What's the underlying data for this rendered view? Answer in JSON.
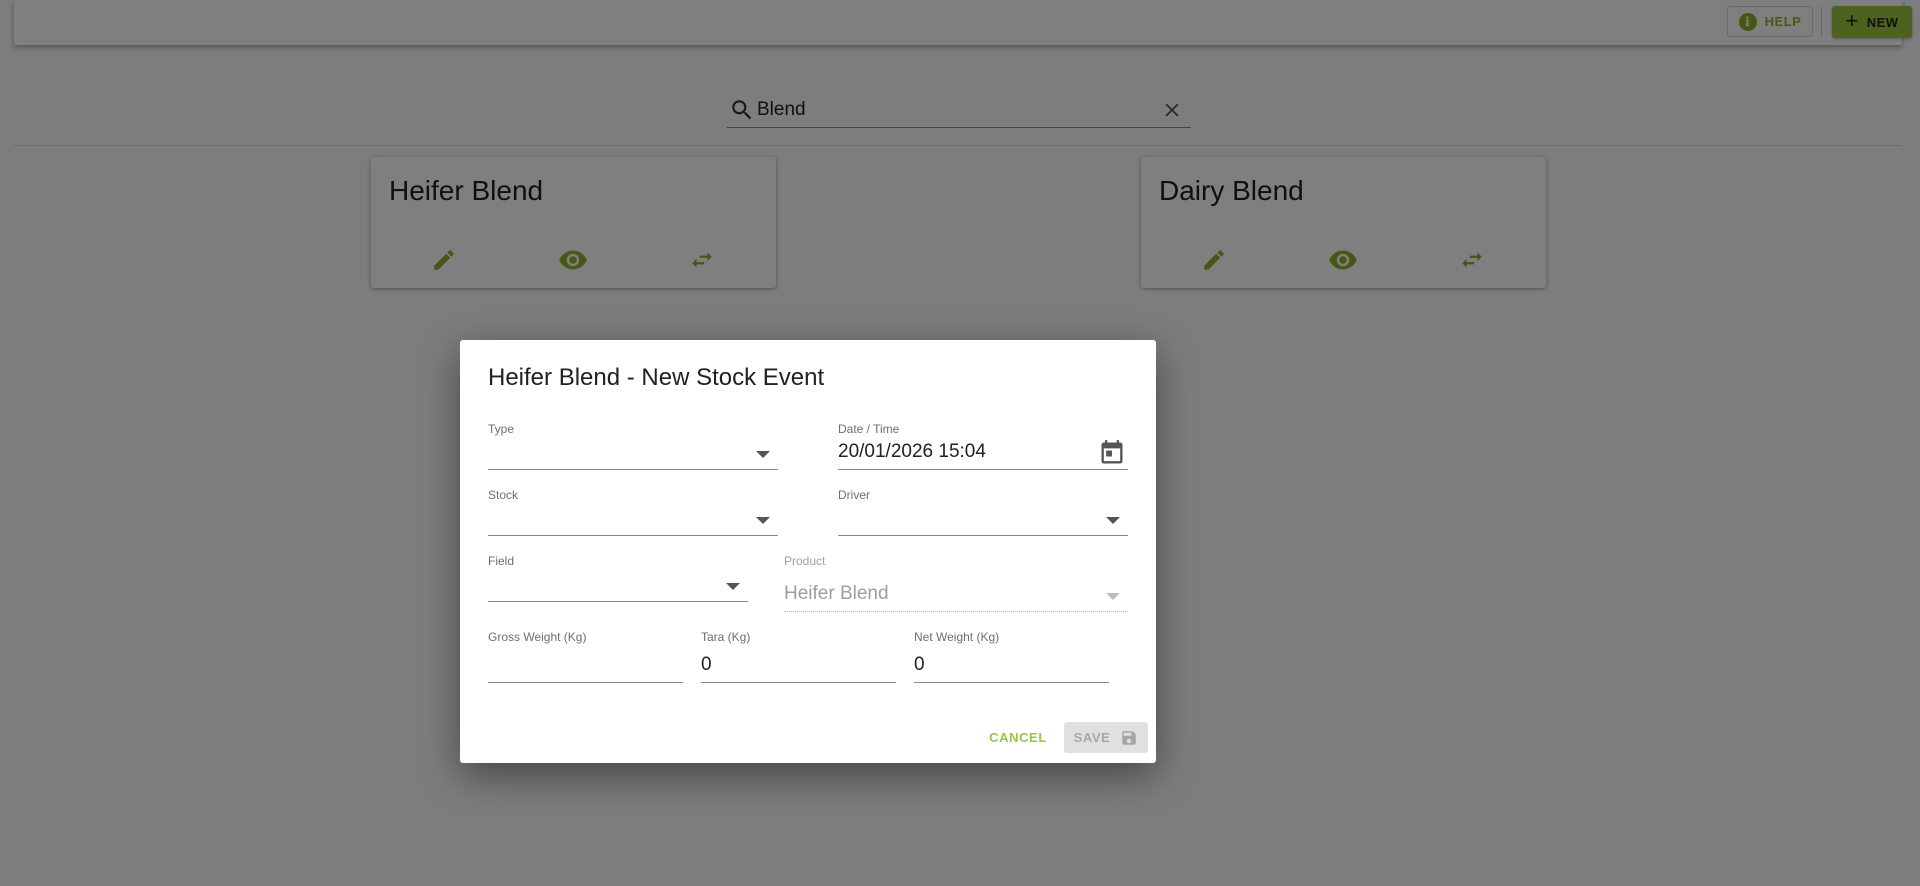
{
  "header": {
    "help_label": "HELP",
    "new_label": "NEW"
  },
  "search": {
    "value": "Blend"
  },
  "cards": [
    {
      "title": "Heifer Blend"
    },
    {
      "title": "Dairy Blend"
    }
  ],
  "dialog": {
    "title": "Heifer Blend - New Stock Event",
    "fields": {
      "type": {
        "label": "Type",
        "value": ""
      },
      "datetime": {
        "label": "Date / Time",
        "value": "20/01/2026 15:04"
      },
      "stock": {
        "label": "Stock",
        "value": ""
      },
      "driver": {
        "label": "Driver",
        "value": ""
      },
      "field": {
        "label": "Field",
        "value": ""
      },
      "product": {
        "label": "Product",
        "value": "Heifer Blend"
      },
      "gross_weight": {
        "label": "Gross Weight (Kg)",
        "value": ""
      },
      "tara": {
        "label": "Tara (Kg)",
        "value": "0"
      },
      "net_weight": {
        "label": "Net Weight (Kg)",
        "value": "0"
      }
    },
    "cancel_label": "CANCEL",
    "save_label": "SAVE"
  },
  "colors": {
    "accent": "#9bc53d",
    "accent_dark": "#8dae2d",
    "overlay": "rgba(0,0,0,0.5)"
  },
  "icons": {
    "help": "info-icon",
    "new": "plus-icon",
    "search": "search-icon",
    "clear": "close-icon",
    "edit": "pencil-icon",
    "view": "eye-icon",
    "transfer": "swap-horizontal-icon",
    "calendar": "calendar-icon",
    "save": "floppy-disk-icon"
  }
}
